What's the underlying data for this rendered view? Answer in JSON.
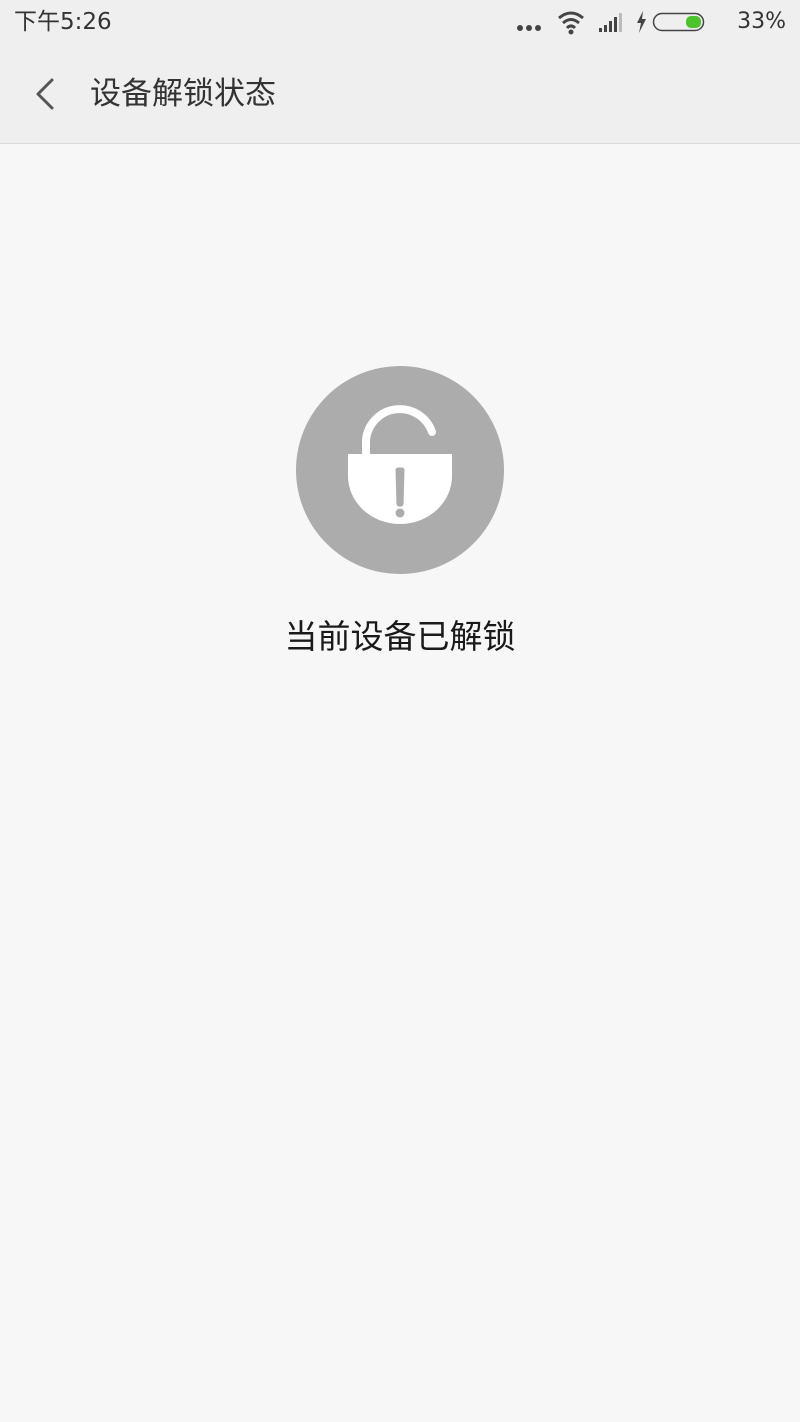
{
  "status_bar": {
    "time": "下午5:26",
    "battery_percent": "33%",
    "icons": [
      "more-dots-icon",
      "wifi-icon",
      "signal-icon",
      "charging-icon",
      "battery-icon"
    ],
    "battery_fill_color": "#4cc22c"
  },
  "header": {
    "title": "设备解锁状态",
    "back_icon": "chevron-left-icon"
  },
  "main": {
    "icon": "unlocked-padlock-warning-icon",
    "icon_bg_color": "#acacac",
    "message": "当前设备已解锁"
  }
}
